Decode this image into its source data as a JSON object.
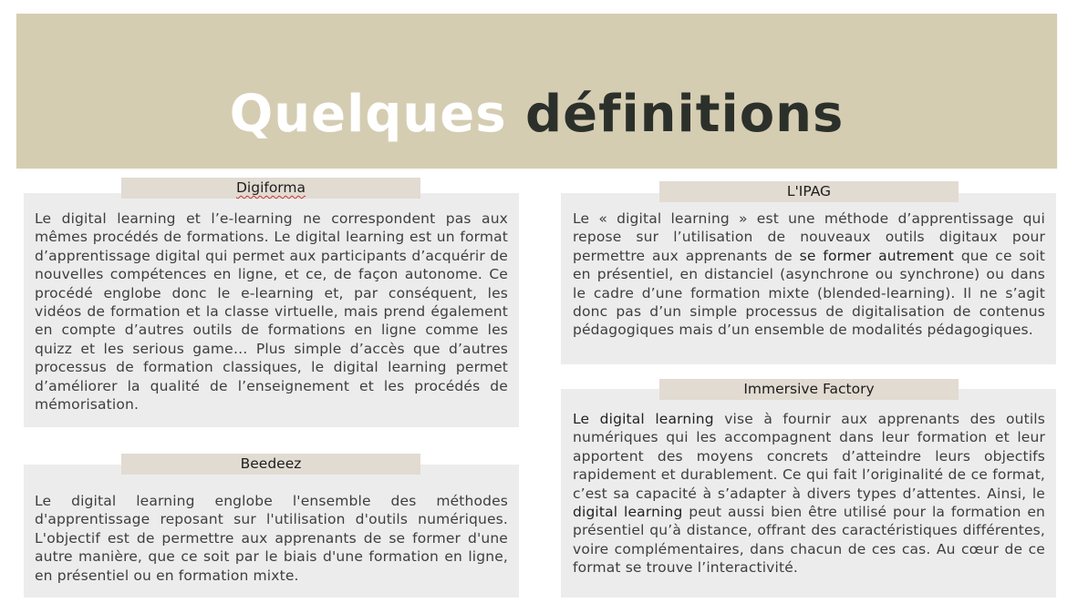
{
  "title": {
    "light": "Quelques",
    "dark": "définitions"
  },
  "sources": {
    "digiforma": {
      "label": "Digiforma",
      "text": "Le digital learning et l’e-learning ne correspondent pas aux mêmes procédés de formations. Le digital learning est un format d’apprentissage digital qui permet aux participants d’acquérir de nouvelles compétences en ligne, et ce, de façon autonome. Ce procédé englobe donc le e-learning et, par conséquent, les vidéos de formation et la classe virtuelle, mais prend également en compte d’autres outils de formations en ligne comme les quizz et les serious game… Plus simple d’accès que d’autres processus de formation classiques, le digital learning permet d’améliorer la qualité de l’enseignement et les procédés de mémorisation."
    },
    "beedeez": {
      "label": "Beedeez",
      "text": "Le digital learning englobe l'ensemble des méthodes d'apprentissage reposant sur l'utilisation d'outils numériques. L'objectif est de permettre aux apprenants de se former d'une autre manière, que ce soit par le biais d'une formation en ligne, en présentiel ou en formation mixte."
    },
    "ipag": {
      "label": "L'IPAG",
      "text_before": "Le « digital learning » est une méthode d’apprentissage qui repose sur l’utilisation de nouveaux outils digitaux pour permettre aux apprenants de ",
      "text_highlight": "se former autrement",
      "text_after": " que ce soit en présentiel, en distanciel (asynchrone ou synchrone) ou dans le cadre d’une formation mixte (blended-learning). Il ne s’agit donc pas d’un simple processus de digitalisation de contenus pédagogiques mais d’un ensemble de modalités pédagogiques."
    },
    "immersive": {
      "label": "Immersive Factory",
      "text_hl1": "Le digital learning",
      "text_mid": " vise à fournir aux apprenants des outils numériques qui les accompagnent dans leur formation et leur apportent des moyens concrets d’atteindre leurs objectifs rapidement et durablement. Ce qui fait l’originalité de ce format, c’est sa capacité à s’adapter à divers types d’attentes. Ainsi, le ",
      "text_hl2": "digital learning",
      "text_end": " peut aussi bien être utilisé pour la formation en présentiel qu’à distance, offrant des caractéristiques différentes, voire complémentaires, dans chacun de ces cas. Au cœur de ce format se trouve l’interactivité."
    }
  },
  "colors": {
    "banner": "#d5cdb2",
    "title_light": "#ffffff",
    "title_dark": "#2c302b",
    "card_bg": "#ececec",
    "label_bg": "#e1dbd2"
  }
}
